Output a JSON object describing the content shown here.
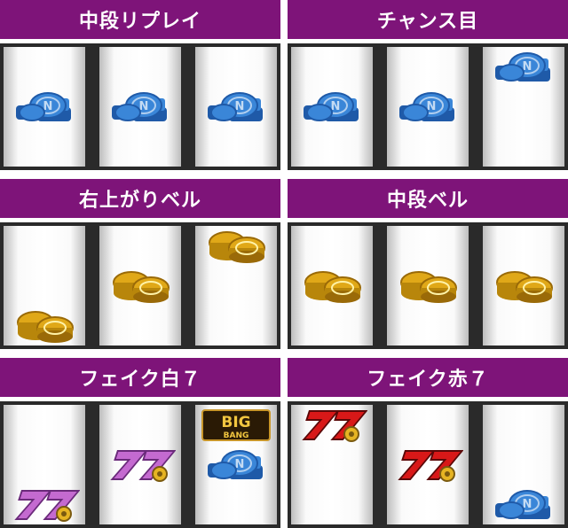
{
  "panels": [
    {
      "title": "中段リプレイ",
      "reels": [
        [
          "",
          "replay",
          ""
        ],
        [
          "",
          "replay",
          ""
        ],
        [
          "",
          "replay",
          ""
        ]
      ]
    },
    {
      "title": "チャンス目",
      "reels": [
        [
          "",
          "replay",
          ""
        ],
        [
          "",
          "replay",
          ""
        ],
        [
          "replay",
          "",
          ""
        ]
      ]
    },
    {
      "title": "右上がりベル",
      "reels": [
        [
          "",
          "",
          "bell"
        ],
        [
          "",
          "bell",
          ""
        ],
        [
          "bell",
          "",
          ""
        ]
      ]
    },
    {
      "title": "中段ベル",
      "reels": [
        [
          "",
          "bell",
          ""
        ],
        [
          "",
          "bell",
          ""
        ],
        [
          "",
          "bell",
          ""
        ]
      ]
    },
    {
      "title": "フェイク白７",
      "reels": [
        [
          "",
          "",
          "white7"
        ],
        [
          "",
          "white7",
          ""
        ],
        [
          "big-bang",
          "replay",
          ""
        ]
      ]
    },
    {
      "title": "フェイク赤７",
      "reels": [
        [
          "red7",
          "",
          ""
        ],
        [
          "",
          "red7",
          ""
        ],
        [
          "",
          "",
          "replay"
        ]
      ]
    }
  ],
  "symbol_colors": {
    "replay": "#3a86d8",
    "bell": "#e0a818",
    "white7": "#c46ad0",
    "red7": "#d81818",
    "big-bang": "#c8962a"
  }
}
